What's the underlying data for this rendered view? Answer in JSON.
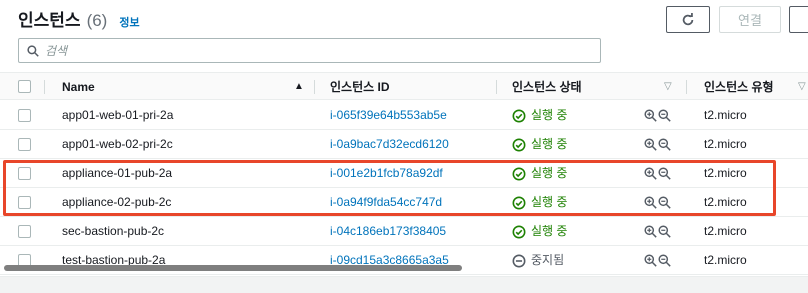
{
  "header": {
    "title": "인스턴스",
    "count": "(6)",
    "info_link": "정보",
    "connect_label": "연결"
  },
  "search": {
    "placeholder": "검색"
  },
  "table": {
    "columns": {
      "name": "Name",
      "instance_id": "인스턴스 ID",
      "state": "인스턴스 상태",
      "type": "인스턴스 유형"
    },
    "rows": [
      {
        "name": "app01-web-01-pri-2a",
        "id": "i-065f39e64b553ab5e",
        "state": "실행 중",
        "status": "running",
        "type": "t2.micro"
      },
      {
        "name": "app01-web-02-pri-2c",
        "id": "i-0a9bac7d32ecd6120",
        "state": "실행 중",
        "status": "running",
        "type": "t2.micro"
      },
      {
        "name": "appliance-01-pub-2a",
        "id": "i-001e2b1fcb78a92df",
        "state": "실행 중",
        "status": "running",
        "type": "t2.micro"
      },
      {
        "name": "appliance-02-pub-2c",
        "id": "i-0a94f9fda54cc747d",
        "state": "실행 중",
        "status": "running",
        "type": "t2.micro"
      },
      {
        "name": "sec-bastion-pub-2c",
        "id": "i-04c186eb173f38405",
        "state": "실행 중",
        "status": "running",
        "type": "t2.micro"
      },
      {
        "name": "test-bastion-pub-2a",
        "id": "i-09cd15a3c8665a3a5",
        "state": "중지됨",
        "status": "stopped",
        "type": "t2.micro"
      }
    ]
  },
  "colors": {
    "running": "#1d8102",
    "stopped": "#545b64",
    "link": "#0073bb",
    "highlight": "#e8462a"
  }
}
